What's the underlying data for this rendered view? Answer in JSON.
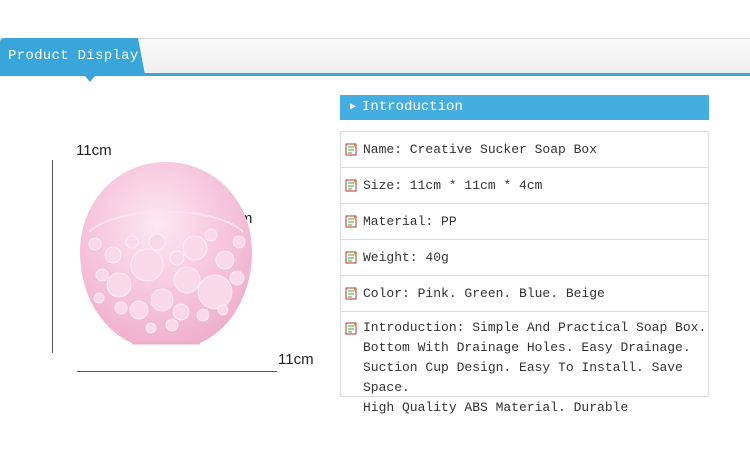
{
  "header": {
    "title": "Product Display"
  },
  "product_image": {
    "height_label": "11cm",
    "depth_label": "4cm",
    "width_label": "11cm"
  },
  "introduction": {
    "title": "Introduction",
    "rows": [
      {
        "text": "Name: Creative Sucker Soap Box"
      },
      {
        "text": "Size: 11cm * 11cm * 4cm"
      },
      {
        "text": "Material: PP"
      },
      {
        "text": "Weight: 40g"
      },
      {
        "text": "Color: Pink. Green. Blue. Beige"
      },
      {
        "lines": [
          "Introduction: Simple And Practical Soap Box.",
          "Bottom With Drainage Holes. Easy Drainage.",
          "Suction Cup Design. Easy To Install. Save Space.",
          "High Quality ABS Material. Durable"
        ]
      }
    ]
  },
  "colors": {
    "accent": "#39a6db",
    "product_pink": "#f3b8d2"
  },
  "icons": {
    "row_icon": "notepad-edit-icon",
    "header_arrow": "triangle-right-icon"
  }
}
